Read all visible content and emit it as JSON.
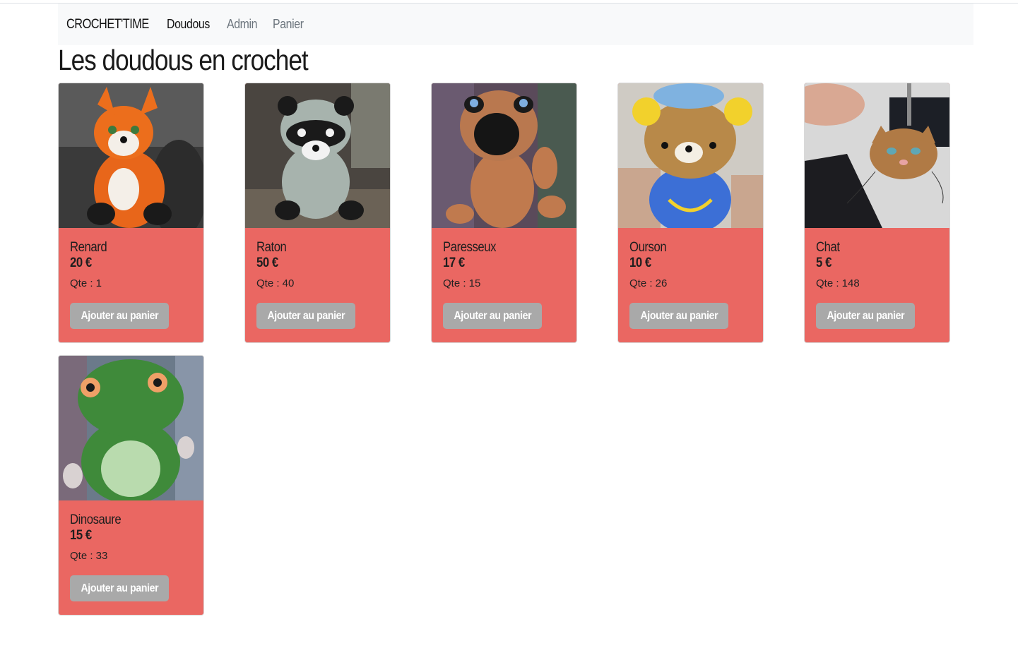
{
  "navbar": {
    "brand": "CROCHET'TIME",
    "links": [
      {
        "label": "Doudous",
        "active": true
      },
      {
        "label": "Admin",
        "active": false
      },
      {
        "label": "Panier",
        "active": false
      }
    ]
  },
  "page": {
    "title": "Les doudous en crochet"
  },
  "products": [
    {
      "name": "Renard",
      "price": "20 €",
      "qty": "Qte : 1",
      "button": "Ajouter au panier",
      "image": "fox-photo"
    },
    {
      "name": "Raton",
      "price": "50 €",
      "qty": "Qte : 40",
      "button": "Ajouter au panier",
      "image": "raccoon-photo"
    },
    {
      "name": "Paresseux",
      "price": "17 €",
      "qty": "Qte : 15",
      "button": "Ajouter au panier",
      "image": "sloth-photo"
    },
    {
      "name": "Ourson",
      "price": "10 €",
      "qty": "Qte : 26",
      "button": "Ajouter au panier",
      "image": "bear-photo"
    },
    {
      "name": "Chat",
      "price": "5 €",
      "qty": "Qte : 148",
      "button": "Ajouter au panier",
      "image": "cat-photo"
    },
    {
      "name": "Dinosaure",
      "price": "15 €",
      "qty": "Qte : 33",
      "button": "Ajouter au panier",
      "image": "dinosaur-photo"
    }
  ],
  "colors": {
    "card_body": "#ea6762",
    "button": "#a9a9a9",
    "navbar_bg": "#f8f9fa"
  }
}
